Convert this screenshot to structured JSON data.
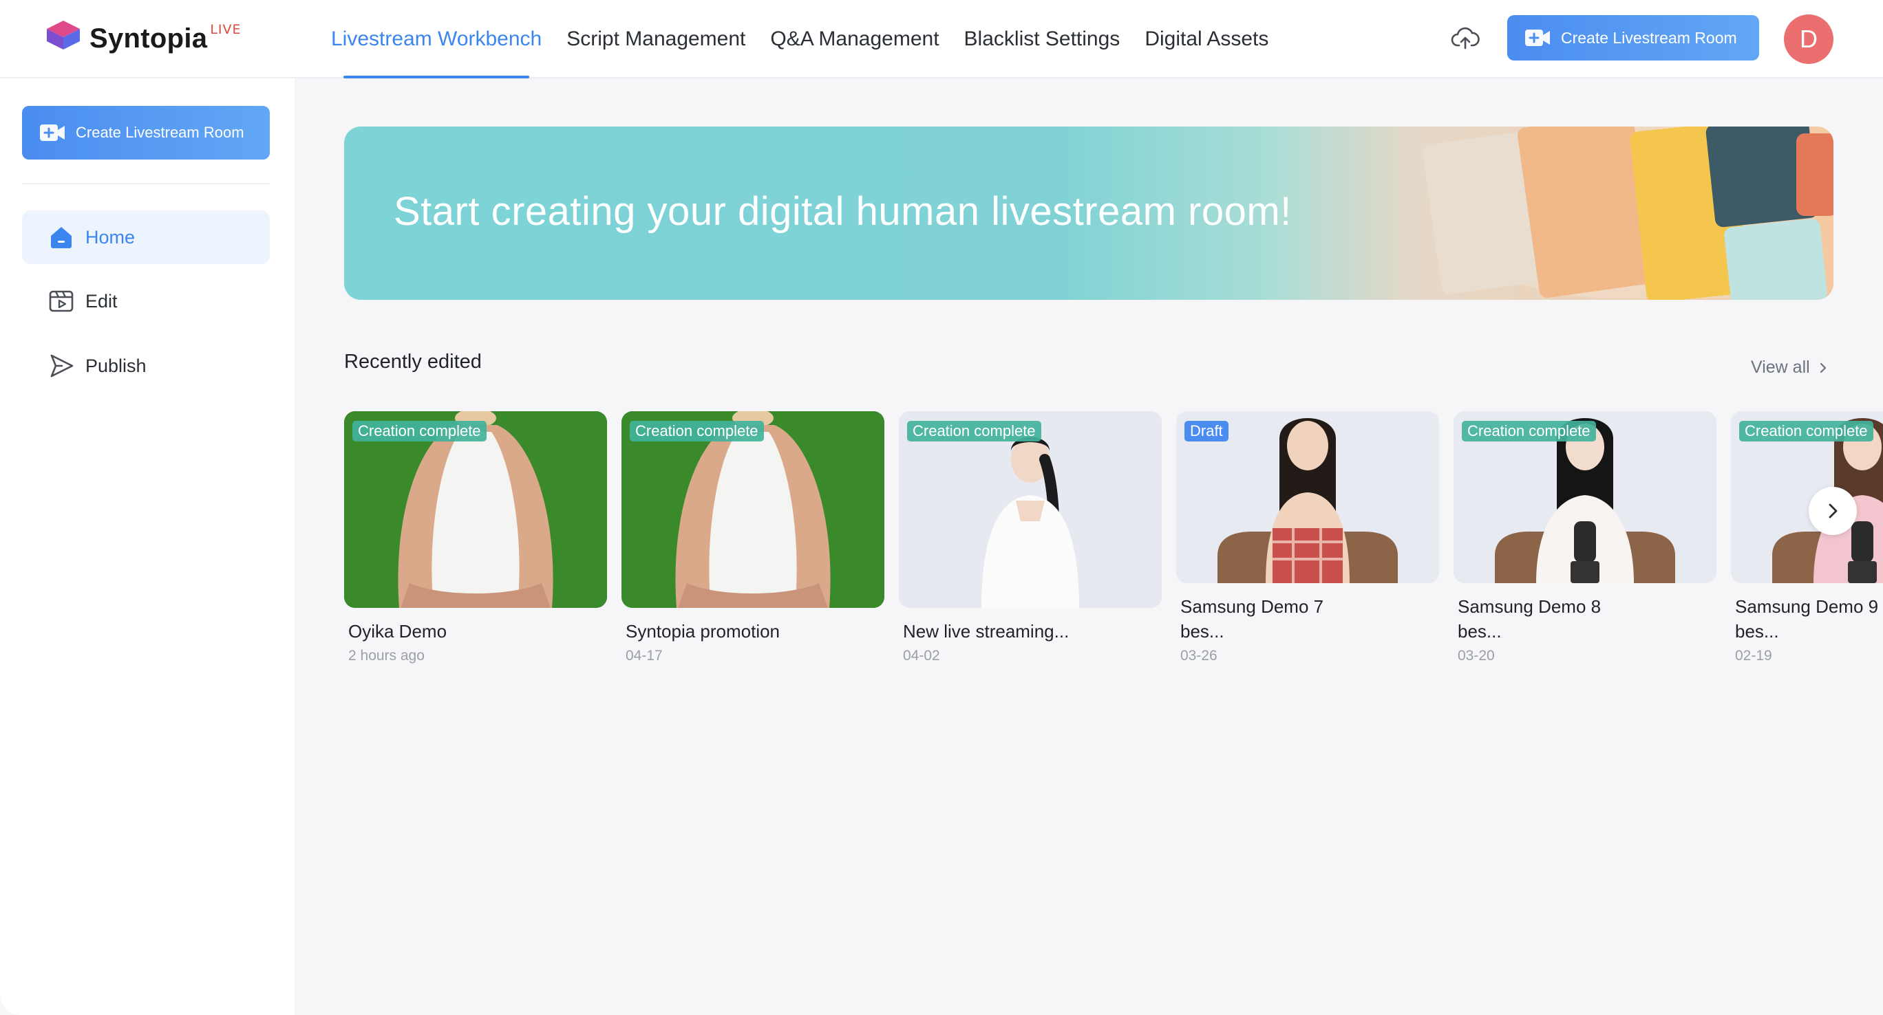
{
  "app": {
    "logo_text": "Syntopia",
    "logo_badge": "LIVE"
  },
  "nav": {
    "tabs": [
      {
        "label": "Livestream Workbench",
        "active": true
      },
      {
        "label": "Script Management",
        "active": false
      },
      {
        "label": "Q&A Management",
        "active": false
      },
      {
        "label": "Blacklist Settings",
        "active": false
      },
      {
        "label": "Digital Assets",
        "active": false
      }
    ],
    "create_button_label": "Create Livestream Room",
    "upload_icon": "cloud-upload-icon",
    "avatar_initial": "D"
  },
  "sidebar": {
    "create_button_label": "Create Livestream Room",
    "items": [
      {
        "label": "Home",
        "icon": "home-icon",
        "active": true
      },
      {
        "label": "Edit",
        "icon": "video-edit-icon",
        "active": false
      },
      {
        "label": "Publish",
        "icon": "send-icon",
        "active": false
      }
    ]
  },
  "banner": {
    "headline": "Start creating your digital human livestream room!"
  },
  "recent": {
    "title": "Recently edited",
    "view_all_label": "View all",
    "cards": [
      {
        "status": "Creation complete",
        "title": "Oyika Demo",
        "time": "2 hours ago"
      },
      {
        "status": "Creation complete",
        "title": "Syntopia promotion",
        "time": "04-17"
      },
      {
        "status": "Creation complete",
        "title": "New live streaming...",
        "time": "04-02"
      },
      {
        "status": "Draft",
        "title": "Samsung Demo 7 bes...",
        "time": "03-26"
      },
      {
        "status": "Creation complete",
        "title": "Samsung Demo 8 bes...",
        "time": "03-20"
      },
      {
        "status": "Creation complete",
        "title": "Samsung Demo 9 bes...",
        "time": "02-19"
      }
    ]
  },
  "colors": {
    "accent": "#3b86ee",
    "avatar": "#ec6f6f",
    "badge_complete": "#42b29b",
    "badge_draft": "#4b8cf0",
    "banner": "#7dd3d6"
  }
}
